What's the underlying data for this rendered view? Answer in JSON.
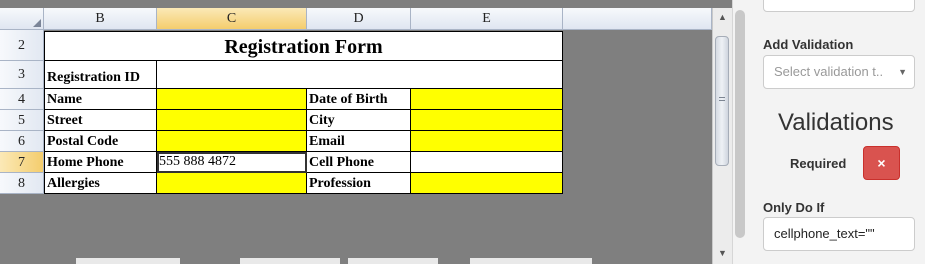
{
  "sheet": {
    "columns": [
      "B",
      "C",
      "D",
      "E"
    ],
    "rows": [
      "2",
      "3",
      "4",
      "5",
      "6",
      "7",
      "8"
    ],
    "title": "Registration Form",
    "labels": {
      "registration_id": "Registration ID",
      "name": "Name",
      "street": "Street",
      "postal_code": "Postal Code",
      "home_phone": "Home Phone",
      "allergies": "Allergies",
      "date_of_birth": "Date of Birth",
      "city": "City",
      "email": "Email",
      "cell_phone": "Cell Phone",
      "profession": "Profession"
    },
    "values": {
      "home_phone": "555 888 4872"
    },
    "selected_column": "C",
    "selected_row": "7",
    "highlight_color": "#ffff00"
  },
  "panel": {
    "add_validation_label": "Add Validation",
    "select_placeholder": "Select validation t..",
    "validations_title": "Validations",
    "required_label": "Required",
    "delete_icon": "×",
    "only_do_if_label": "Only Do If",
    "only_do_if_value": "cellphone_text=\"\"",
    "accent_danger": "#d9534f"
  },
  "scrollbar": {
    "up_arrow": "▲",
    "down_arrow": "▼"
  }
}
